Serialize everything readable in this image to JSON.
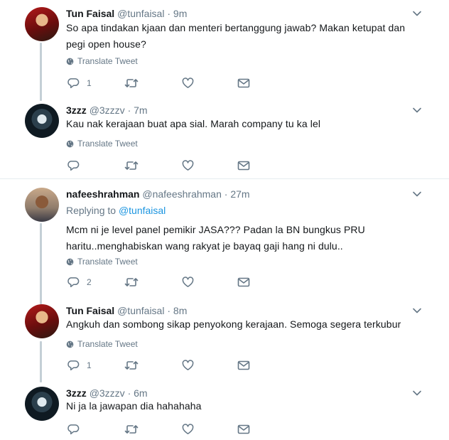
{
  "icons": {
    "chevron": "chevron-down-icon",
    "globe": "globe-icon",
    "reply": "reply-icon",
    "retweet": "retweet-icon",
    "like": "like-icon",
    "message": "message-icon"
  },
  "colors": {
    "link": "#1b95e0",
    "muted": "#657786",
    "thread_line": "#c4cfd6",
    "divider": "#e6ecf0"
  },
  "translate_label": "Translate Tweet",
  "thread1": {
    "tweet1": {
      "name": "Tun Faisal",
      "handle": "@tunfaisal",
      "dot": "·",
      "time": "9m",
      "lines": [
        "So apa tindakan kjaan dan menteri bertanggung jawab? Makan ketupat dan",
        "pegi open house?"
      ],
      "reply_count": "1"
    },
    "tweet2": {
      "name": "3zzz",
      "handle": "@3zzzv",
      "dot": "·",
      "time": "7m",
      "lines": [
        "Kau nak kerajaan buat apa sial. Marah company tu ka lel"
      ],
      "reply_count": ""
    }
  },
  "thread2": {
    "tweet1": {
      "name": "nafeeshrahman",
      "handle": "@nafeeshrahman",
      "dot": "·",
      "time": "27m",
      "replying_prefix": "Replying to",
      "replying_handle": "@tunfaisal",
      "lines": [
        "Mcm ni je level panel pemikir JASA??? Padan la BN bungkus PRU",
        "haritu..menghabiskan wang rakyat je bayaq gaji hang ni dulu.."
      ],
      "reply_count": "2"
    },
    "tweet2": {
      "name": "Tun Faisal",
      "handle": "@tunfaisal",
      "dot": "·",
      "time": "8m",
      "lines": [
        "Angkuh dan sombong sikap penyokong kerajaan. Semoga segera terkubur"
      ],
      "reply_count": "1"
    },
    "tweet3": {
      "name": "3zzz",
      "handle": "@3zzzv",
      "dot": "·",
      "time": "6m",
      "lines": [
        "Ni ja la jawapan dia hahahaha"
      ],
      "reply_count": ""
    }
  }
}
